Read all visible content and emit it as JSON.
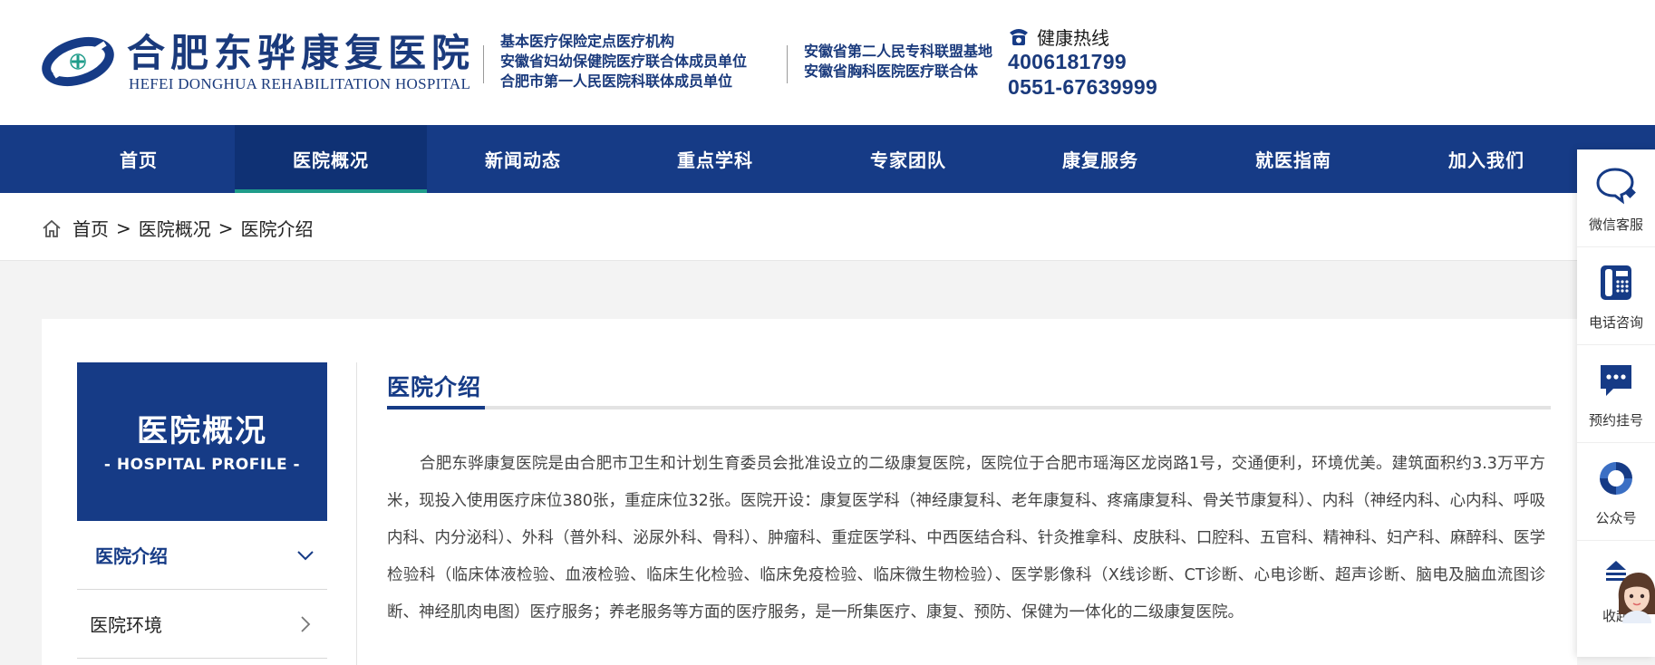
{
  "header": {
    "name_cn": "合肥东骅康复医院",
    "name_en": "HEFEI DONGHUA REHABILITATION HOSPITAL",
    "quals_left": [
      "基本医疗保险定点医疗机构",
      "安徽省妇幼保健院医疗联合体成员单位",
      "合肥市第一人民医院科联体成员单位"
    ],
    "quals_right": [
      "安徽省第二人民专科联盟基地",
      "安徽省胸科医院医疗联合体"
    ],
    "hotline_label": "健康热线",
    "hotline_numbers": [
      "4006181799",
      "0551-67639999"
    ]
  },
  "nav": {
    "items": [
      {
        "label": "首页"
      },
      {
        "label": "医院概况"
      },
      {
        "label": "新闻动态"
      },
      {
        "label": "重点学科"
      },
      {
        "label": "专家团队"
      },
      {
        "label": "康复服务"
      },
      {
        "label": "就医指南"
      },
      {
        "label": "加入我们"
      }
    ],
    "active_index": 1
  },
  "breadcrumb": {
    "items": [
      "首页",
      "医院概况",
      "医院介绍"
    ],
    "separator": ">"
  },
  "sidebar": {
    "title": "医院概况",
    "subtitle": "- HOSPITAL PROFILE -",
    "items": [
      {
        "label": "医院介绍",
        "icon": "chevron-down-icon"
      },
      {
        "label": "医院环境",
        "icon": "chevron-right-icon"
      }
    ]
  },
  "content": {
    "title": "医院介绍",
    "body": "合肥东骅康复医院是由合肥市卫生和计划生育委员会批准设立的二级康复医院，医院位于合肥市瑶海区龙岗路1号，交通便利，环境优美。建筑面积约3.3万平方米，现投入使用医疗床位380张，重症床位32张。医院开设：康复医学科（神经康复科、老年康复科、疼痛康复科、骨关节康复科）、内科（神经内科、心内科、呼吸内科、内分泌科）、外科（普外科、泌尿外科、骨科）、肿瘤科、重症医学科、中西医结合科、针灸推拿科、皮肤科、口腔科、五官科、精神科、妇产科、麻醉科、医学检验科（临床体液检验、血液检验、临床生化检验、临床免疫检验、临床微生物检验）、医学影像科（X线诊断、CT诊断、心电诊断、超声诊断、脑电及脑血流图诊断、神经肌肉电图）医疗服务；养老服务等方面的医疗服务，是一所集医疗、康复、预防、保健为一体化的二级康复医院。"
  },
  "float_bar": {
    "items": [
      {
        "label": "微信客服",
        "icon": "wechat-chat-icon"
      },
      {
        "label": "电话咨询",
        "icon": "telephone-icon"
      },
      {
        "label": "预约挂号",
        "icon": "message-icon"
      },
      {
        "label": "公众号",
        "icon": "official-account-icon"
      },
      {
        "label": "收起",
        "icon": "collapse-icon"
      }
    ]
  },
  "colors": {
    "brand": "#163b86",
    "accent": "#1f9c8a"
  }
}
